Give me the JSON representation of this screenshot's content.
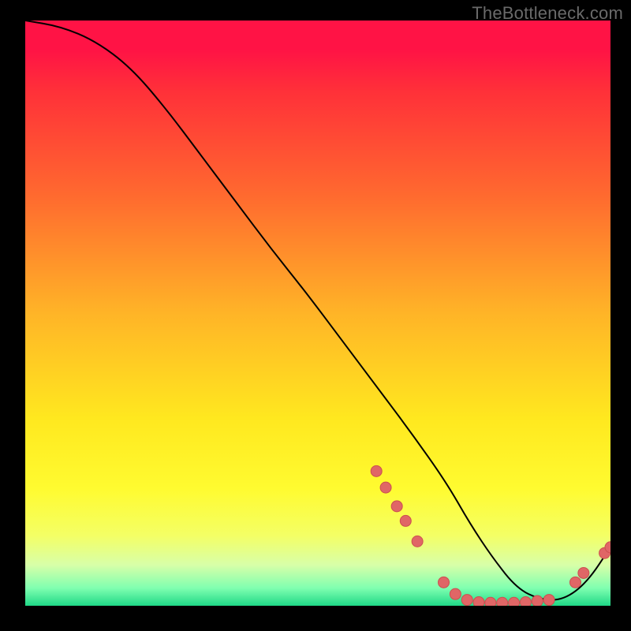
{
  "watermark": "TheBottleneck.com",
  "chart_data": {
    "type": "line",
    "title": "",
    "xlabel": "",
    "ylabel": "",
    "xlim": [
      0,
      100
    ],
    "ylim": [
      0,
      100
    ],
    "series": [
      {
        "name": "curve",
        "x": [
          0,
          6,
          12,
          18,
          24,
          30,
          36,
          42,
          48,
          54,
          60,
          66,
          72,
          76,
          80,
          84,
          88,
          92,
          96,
          100
        ],
        "values": [
          100,
          99,
          96.5,
          92,
          85,
          77,
          69,
          61,
          53.5,
          45.5,
          37.5,
          29.5,
          21,
          14,
          8,
          3,
          1,
          1,
          4,
          10
        ]
      }
    ],
    "markers": [
      {
        "x": 60.0,
        "y": 23.0
      },
      {
        "x": 61.6,
        "y": 20.2
      },
      {
        "x": 63.5,
        "y": 17.0
      },
      {
        "x": 65.0,
        "y": 14.5
      },
      {
        "x": 67.0,
        "y": 11.0
      },
      {
        "x": 71.5,
        "y": 4.0
      },
      {
        "x": 73.5,
        "y": 2.0
      },
      {
        "x": 75.5,
        "y": 1.0
      },
      {
        "x": 77.5,
        "y": 0.6
      },
      {
        "x": 79.5,
        "y": 0.5
      },
      {
        "x": 81.5,
        "y": 0.5
      },
      {
        "x": 83.5,
        "y": 0.5
      },
      {
        "x": 85.5,
        "y": 0.6
      },
      {
        "x": 87.5,
        "y": 0.8
      },
      {
        "x": 89.5,
        "y": 1.0
      },
      {
        "x": 94.0,
        "y": 4.0
      },
      {
        "x": 95.4,
        "y": 5.6
      },
      {
        "x": 99.0,
        "y": 9.0
      },
      {
        "x": 100.0,
        "y": 10.0
      }
    ],
    "colors": {
      "curve": "#000000",
      "marker_fill": "#e06666",
      "marker_stroke": "#cc4f4f"
    }
  }
}
